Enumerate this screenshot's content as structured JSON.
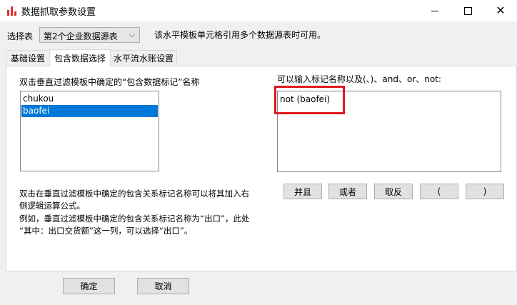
{
  "window": {
    "title": "数据抓取参数设置",
    "controls": {
      "close_glyph": "✕"
    }
  },
  "selector": {
    "label": "选择表",
    "selected_value": "第2个企业数据源表",
    "hint": "该水平模板单元格引用多个数据源表时可用。"
  },
  "tabs": [
    {
      "label": "基础设置",
      "active": false
    },
    {
      "label": "包含数据选择",
      "active": true
    },
    {
      "label": "水平流水账设置",
      "active": false
    }
  ],
  "left_panel": {
    "heading": "双击垂直过滤模板中确定的“包含数据标记”名称",
    "items": [
      {
        "label": "chukou",
        "selected": false
      },
      {
        "label": "baofei",
        "selected": true
      }
    ]
  },
  "right_panel": {
    "heading": "可以输入标记名称以及(、)、and、or、not:",
    "expression": "not (baofei)"
  },
  "operators": [
    {
      "label": "并且"
    },
    {
      "label": "或者"
    },
    {
      "label": "取反"
    },
    {
      "label": "("
    },
    {
      "label": ")"
    }
  ],
  "help": {
    "line1": "双击在垂直过滤模板中确定的包含关系标记名称可以将其加入右",
    "line2": "侧逻辑运算公式。",
    "line3": "例如，垂直过滤模板中确定的包含关系标记名称为“出口”，此处",
    "line4": "“其中：出口交货额”这一列，可以选择“出口”。"
  },
  "footer": {
    "ok_label": "确定",
    "cancel_label": "取消"
  },
  "colors": {
    "selection": "#0078d7",
    "highlight_border": "#e0181f",
    "app_icon": "#e0302b"
  },
  "icons": {
    "app": "bar-chart-icon",
    "minimize": "minimize-icon",
    "maximize": "maximize-icon",
    "close": "close-icon",
    "dropdown": "chevron-down-icon"
  }
}
